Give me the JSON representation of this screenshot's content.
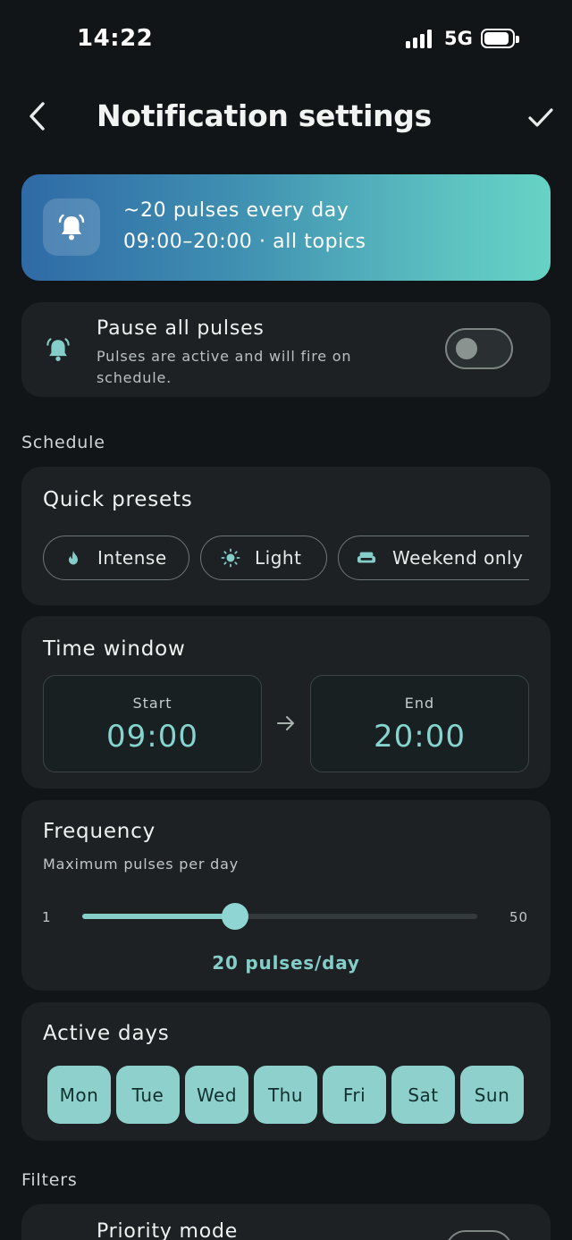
{
  "status": {
    "time": "14:22",
    "network": "5G"
  },
  "header": {
    "title": "Notification settings",
    "back_icon": "chevron-left-icon",
    "confirm_icon": "check-icon"
  },
  "hero": {
    "line1": "~20 pulses every day",
    "line2": "09:00–20:00 · all topics",
    "icon": "bell-ring-icon",
    "colors": {
      "start": "#2f6aa6",
      "end": "#66d3c5"
    }
  },
  "pause": {
    "title": "Pause all pulses",
    "subtitle": "Pulses are active and will fire on schedule.",
    "enabled": false
  },
  "sections": {
    "schedule": "Schedule",
    "filters": "Filters"
  },
  "presets": {
    "title": "Quick presets",
    "items": [
      {
        "label": "Intense",
        "icon": "flame-icon"
      },
      {
        "label": "Light",
        "icon": "sun-icon"
      },
      {
        "label": "Weekend only",
        "icon": "sofa-icon"
      }
    ]
  },
  "time_window": {
    "title": "Time window",
    "start_label": "Start",
    "start": "09:00",
    "end_label": "End",
    "end": "20:00"
  },
  "frequency": {
    "title": "Frequency",
    "subtitle": "Maximum pulses per day",
    "min": "1",
    "max": "50",
    "value": 20,
    "value_label": "20 pulses/day"
  },
  "active_days": {
    "title": "Active days",
    "days": [
      "Mon",
      "Tue",
      "Wed",
      "Thu",
      "Fri",
      "Sat",
      "Sun"
    ]
  },
  "priority": {
    "title": "Priority mode"
  },
  "accent": "#84cdc9"
}
